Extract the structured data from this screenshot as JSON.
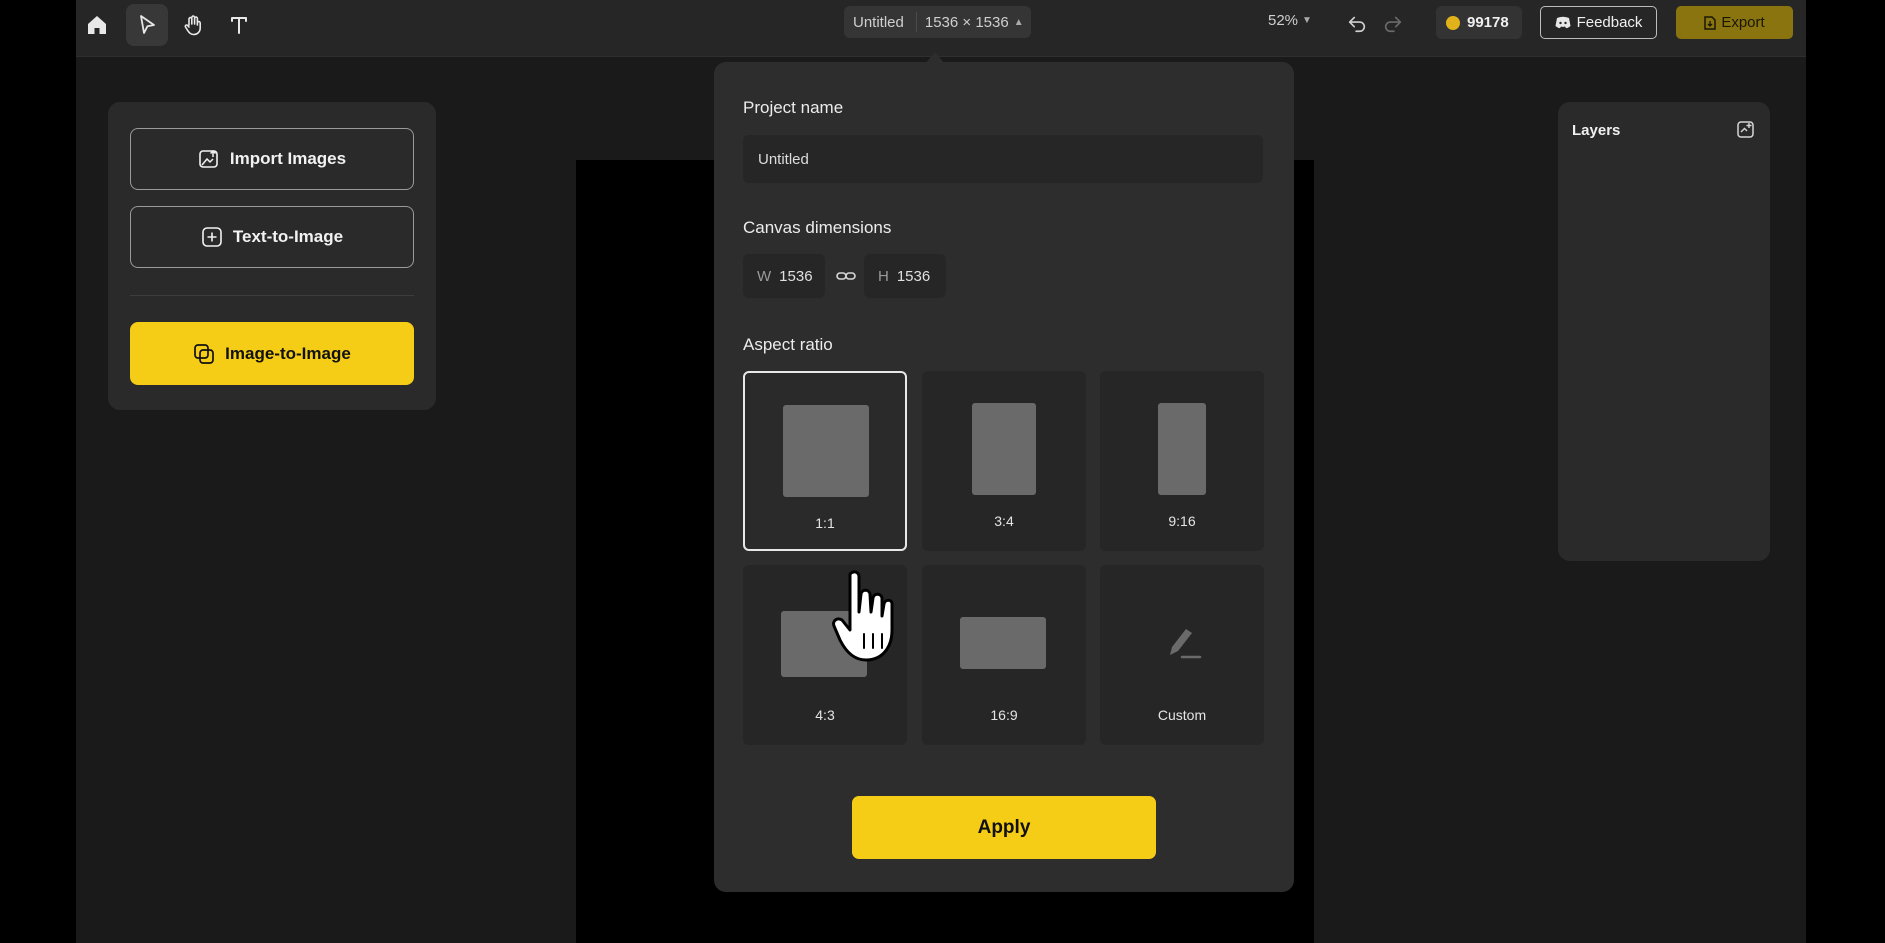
{
  "topbar": {
    "tools": [
      "home-icon",
      "select-icon",
      "hand-icon",
      "text-icon"
    ],
    "project_title": "Untitled",
    "dimensions_label": "1536 × 1536",
    "zoom": "52%",
    "credits": "99178",
    "feedback_label": "Feedback",
    "export_label": "Export"
  },
  "left_panel": {
    "import_label": "Import Images",
    "text_to_image_label": "Text-to-Image",
    "image_to_image_label": "Image-to-Image"
  },
  "layers_panel": {
    "title": "Layers"
  },
  "modal": {
    "project_name_label": "Project name",
    "project_name_value": "Untitled",
    "canvas_dimensions_label": "Canvas dimensions",
    "width_key": "W",
    "width_value": "1536",
    "height_key": "H",
    "height_value": "1536",
    "aspect_ratio_label": "Aspect ratio",
    "ratios": [
      {
        "label": "1:1",
        "selected": true
      },
      {
        "label": "3:4",
        "selected": false
      },
      {
        "label": "9:16",
        "selected": false
      },
      {
        "label": "4:3",
        "selected": false
      },
      {
        "label": "16:9",
        "selected": false
      },
      {
        "label": "Custom",
        "selected": false
      }
    ],
    "apply_label": "Apply"
  },
  "colors": {
    "accent": "#f5cc16",
    "background": "#1a1a1a",
    "panel": "#2a2a2a",
    "modal": "#2d2d2d",
    "coin": "#e2b21b"
  }
}
